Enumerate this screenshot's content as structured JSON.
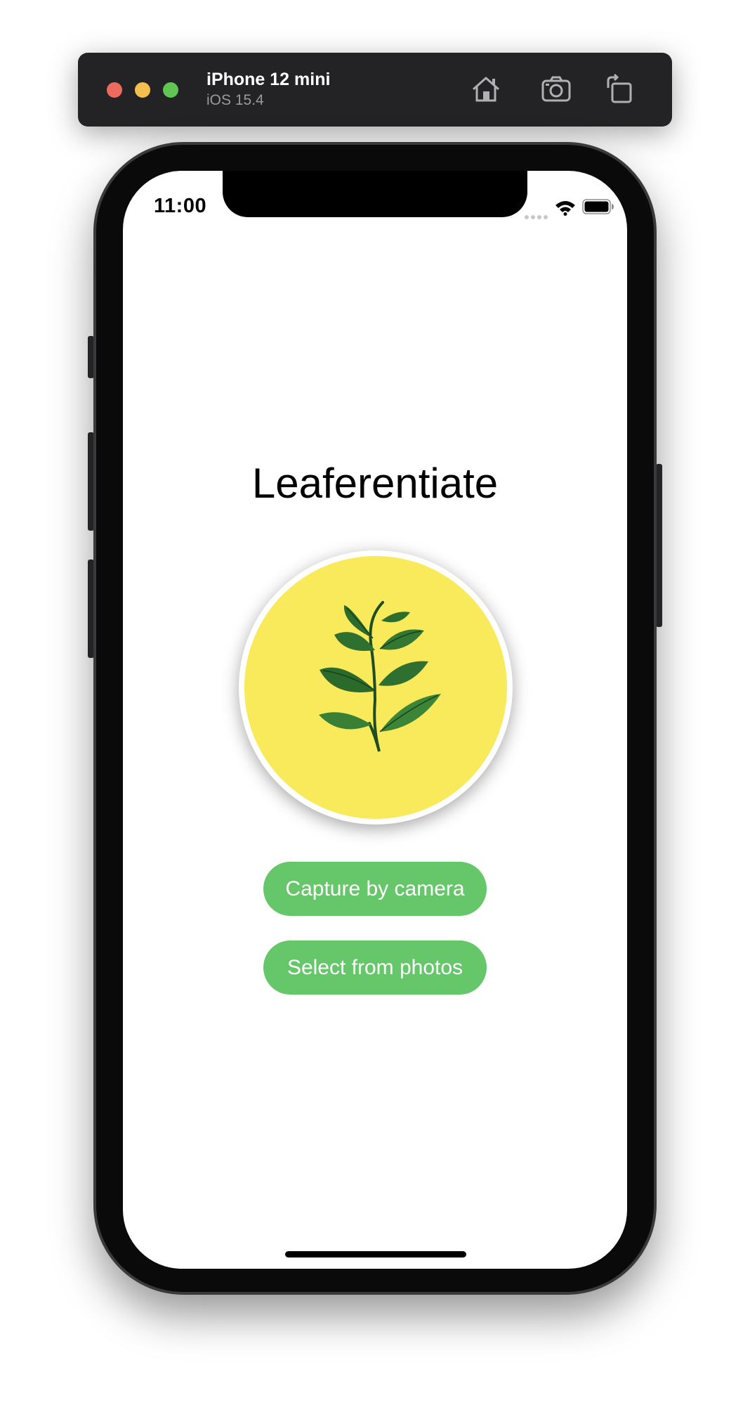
{
  "simulator": {
    "device_name": "iPhone 12 mini",
    "os_version": "iOS 15.4",
    "toolbar_icons": [
      "home-icon",
      "screenshot-icon",
      "rotate-icon"
    ],
    "traffic_lights": {
      "close": "#ed6a5e",
      "minimize": "#f5bf4f",
      "zoom": "#61c554"
    }
  },
  "status_bar": {
    "time": "11:00",
    "icons": [
      "cellular-dots-icon",
      "wifi-icon",
      "battery-icon"
    ]
  },
  "app": {
    "title": "Leaferentiate",
    "logo": {
      "icon": "leaf-sprig-icon",
      "background_color": "#f8ea5a"
    },
    "buttons": {
      "capture_label": "Capture by camera",
      "select_label": "Select from photos",
      "color": "#66c66a"
    }
  }
}
